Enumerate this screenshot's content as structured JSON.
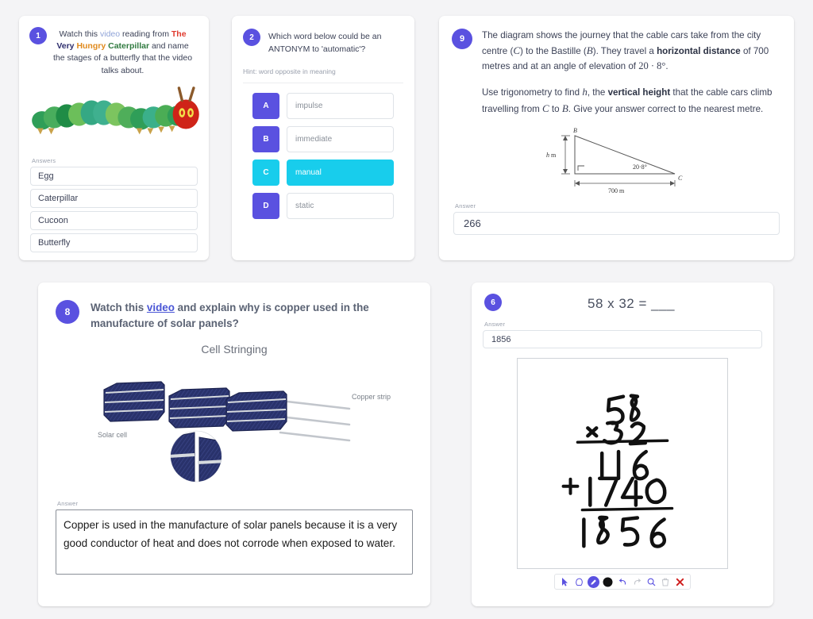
{
  "page": {
    "background": "#f4f4f6",
    "accent": "#5a51e0",
    "selected_color": "#18cdec"
  },
  "cards": {
    "card1": {
      "number": "1",
      "question_parts": {
        "p1": "Watch this ",
        "link": "video",
        "p2": " reading from ",
        "title_the": "The",
        "title_very": "Very",
        "title_hungry": "Hungry",
        "title_caterpillar": "Caterpillar",
        "p3": " and name the stages of a butterfly that the video talks about."
      },
      "image_name": "hungry-caterpillar-illustration",
      "answers_label": "Answers",
      "answers": [
        "Egg",
        "Caterpillar",
        "Cucoon",
        "Butterfly"
      ]
    },
    "card2": {
      "number": "2",
      "question": "Which word below could be an ANTONYM to 'automatic'?",
      "hint": "Hint: word opposite in meaning",
      "options": [
        {
          "letter": "A",
          "value": "impulse",
          "selected": false
        },
        {
          "letter": "B",
          "value": "immediate",
          "selected": false
        },
        {
          "letter": "C",
          "value": "manual",
          "selected": true
        },
        {
          "letter": "D",
          "value": "static",
          "selected": false
        }
      ]
    },
    "card9": {
      "number": "9",
      "para1": {
        "t1": "The diagram shows the journey that the cable cars take from the city centre (",
        "var_c": "C",
        "t2": ") to the Bastille (",
        "var_b": "B",
        "t3": "). They travel a ",
        "bold1": "horizontal distance",
        "t4": " of 700 metres and at an angle of elevation of ",
        "angle": "20 · 8°",
        "t5": "."
      },
      "para2": {
        "t1": "Use trigonometry to find ",
        "var_h": "h",
        "t2": ", the ",
        "bold1": "vertical height",
        "t3": " that the cable cars climb travelling from ",
        "var_c": "C",
        "t4": " to ",
        "var_b": "B",
        "t5": ". Give your answer correct to the nearest metre."
      },
      "diagram": {
        "name": "right-triangle-diagram",
        "label_b": "B",
        "label_c": "C",
        "label_h": "h m",
        "label_angle": "20·8°",
        "label_base": "700 m"
      },
      "answer_label": "Answer",
      "answer_value": "266"
    },
    "card8": {
      "number": "8",
      "question": {
        "t1": "Watch this ",
        "link": "video",
        "t2": " and explain why is copper used in the manufacture of solar panels?"
      },
      "diagram": {
        "name": "cell-stringing-diagram",
        "title": "Cell Stringing",
        "label_copper": "Copper strip",
        "label_cell": "Solar cell"
      },
      "answer_label": "Answer",
      "answer_value": "Copper is used in the manufacture of solar panels because it is a very good conductor of heat and does not corrode when exposed to water."
    },
    "card6": {
      "number": "6",
      "equation": "58 x 32 = ___",
      "answer_label": "Answer",
      "answer_value": "1856",
      "canvas": {
        "name": "handwriting-canvas",
        "line1": "5 8",
        "line2_op": "x",
        "line2": "3 2",
        "line3": "1 1 6",
        "line4_op": "+",
        "line4": "1 7 4 0",
        "line5": "1 8 5 6"
      },
      "toolbar": [
        {
          "name": "cursor-icon",
          "active": false
        },
        {
          "name": "hand-icon",
          "active": false
        },
        {
          "name": "pen-icon",
          "active": true
        },
        {
          "name": "color-swatch-black-icon",
          "active": false
        },
        {
          "name": "undo-icon",
          "active": false
        },
        {
          "name": "redo-icon",
          "active": false
        },
        {
          "name": "zoom-icon",
          "active": false
        },
        {
          "name": "trash-icon",
          "active": false
        },
        {
          "name": "close-icon",
          "active": false
        }
      ]
    }
  }
}
